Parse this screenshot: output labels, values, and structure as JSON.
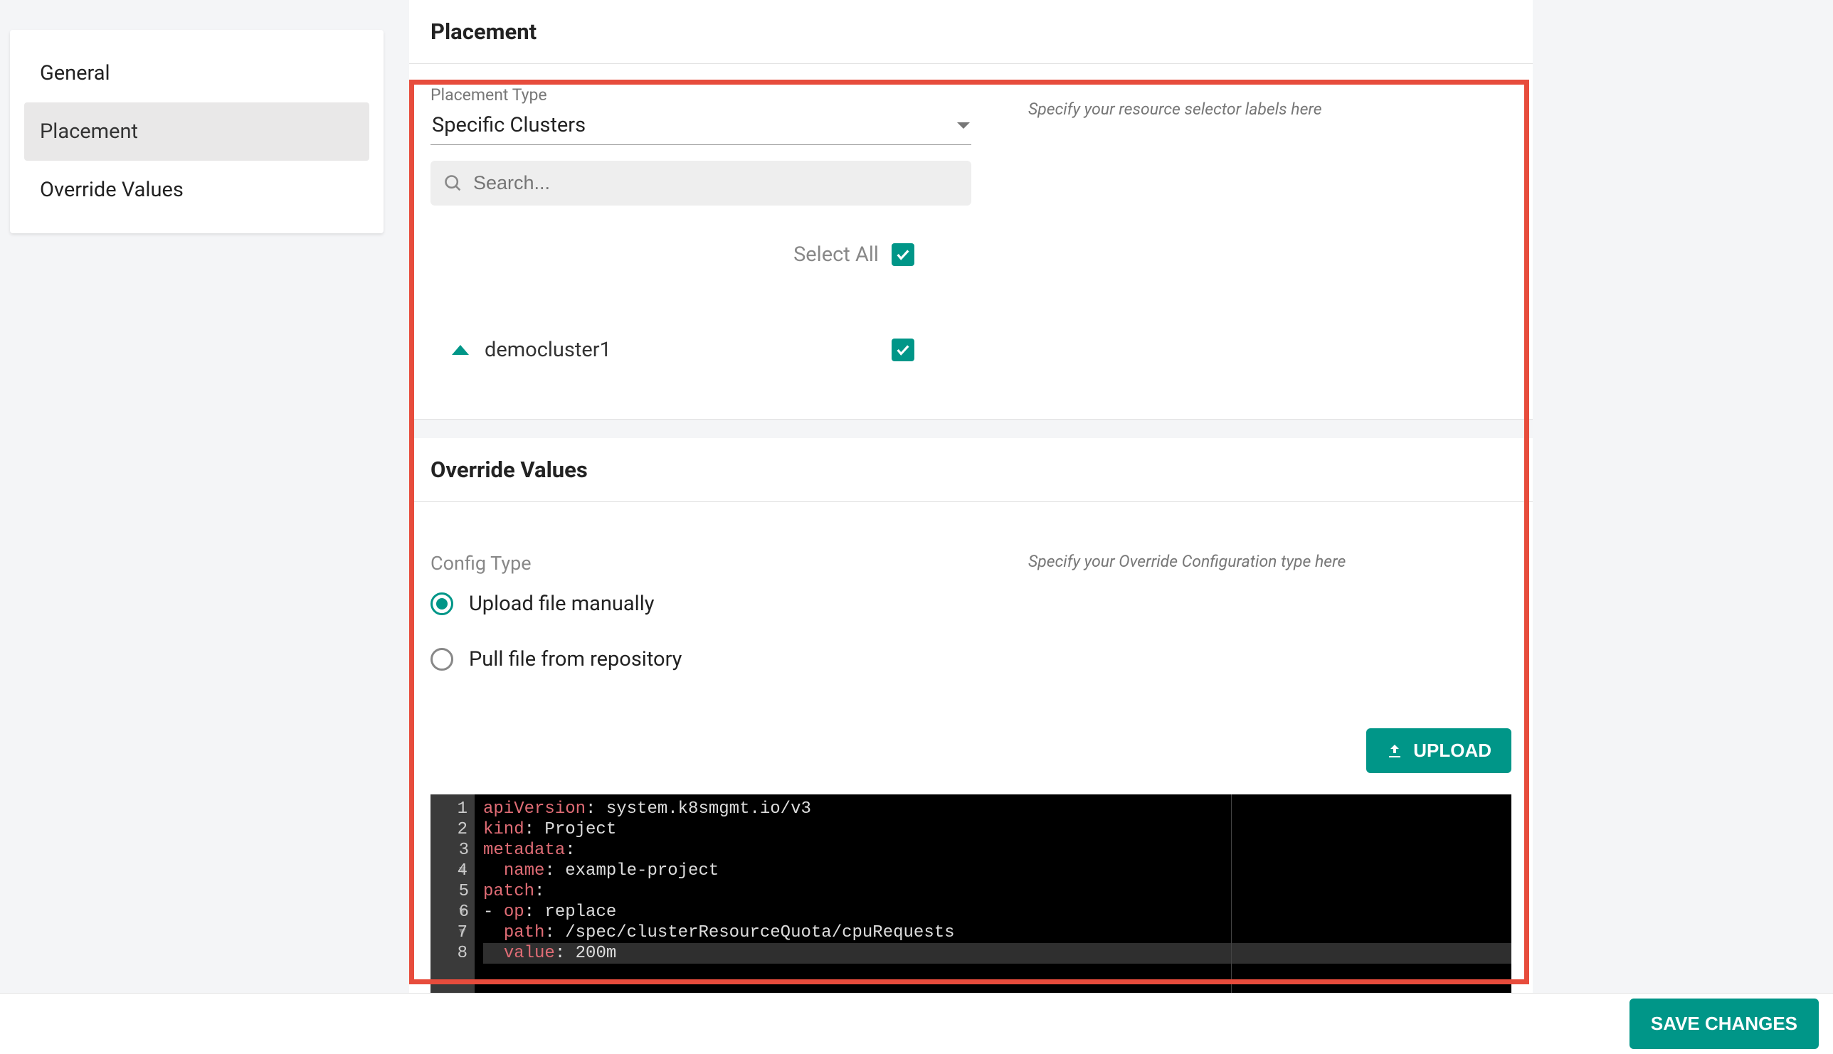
{
  "sidebar": {
    "items": [
      {
        "label": "General",
        "active": false
      },
      {
        "label": "Placement",
        "active": true
      },
      {
        "label": "Override Values",
        "active": false
      }
    ]
  },
  "placement": {
    "section_title": "Placement",
    "type_label": "Placement Type",
    "type_value": "Specific Clusters",
    "search_placeholder": "Search...",
    "select_all_label": "Select All",
    "select_all_checked": true,
    "clusters": [
      {
        "name": "democluster1",
        "checked": true,
        "expanded": true
      }
    ],
    "selector_hint": "Specify your resource selector labels here"
  },
  "override": {
    "section_title": "Override Values",
    "config_type_label": "Config Type",
    "config_type_hint": "Specify your Override Configuration type here",
    "options": [
      {
        "label": "Upload file manually",
        "selected": true
      },
      {
        "label": "Pull file from repository",
        "selected": false
      }
    ],
    "upload_label": "UPLOAD",
    "editor": {
      "lines": [
        {
          "n": 1,
          "tokens": [
            [
              "key",
              "apiVersion"
            ],
            [
              "punc",
              ":"
            ],
            [
              "val",
              " system.k8smgmt.io/v3"
            ]
          ]
        },
        {
          "n": 2,
          "tokens": [
            [
              "key",
              "kind"
            ],
            [
              "punc",
              ":"
            ],
            [
              "val",
              " Project"
            ]
          ]
        },
        {
          "n": 3,
          "fold": true,
          "tokens": [
            [
              "key",
              "metadata"
            ],
            [
              "punc",
              ":"
            ]
          ]
        },
        {
          "n": 4,
          "indent": 1,
          "tokens": [
            [
              "key",
              "name"
            ],
            [
              "punc",
              ":"
            ],
            [
              "val",
              " example-project"
            ]
          ]
        },
        {
          "n": 5,
          "fold": true,
          "tokens": [
            [
              "key",
              "patch"
            ],
            [
              "punc",
              ":"
            ]
          ]
        },
        {
          "n": 6,
          "fold": true,
          "tokens": [
            [
              "punc",
              "- "
            ],
            [
              "key",
              "op"
            ],
            [
              "punc",
              ":"
            ],
            [
              "val",
              " replace"
            ]
          ]
        },
        {
          "n": 7,
          "indent": 1,
          "tokens": [
            [
              "key",
              "path"
            ],
            [
              "punc",
              ":"
            ],
            [
              "val",
              " /spec/clusterResourceQuota/cpuRequests"
            ]
          ]
        },
        {
          "n": 8,
          "indent": 1,
          "active": true,
          "tokens": [
            [
              "key",
              "value"
            ],
            [
              "punc",
              ":"
            ],
            [
              "val",
              " 200m"
            ]
          ]
        }
      ]
    }
  },
  "footer": {
    "save_label": "SAVE CHANGES"
  }
}
